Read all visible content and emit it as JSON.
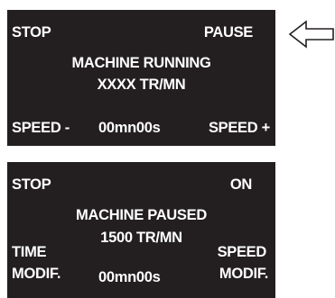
{
  "running_screen": {
    "top_left": "STOP",
    "top_right": "PAUSE",
    "status": "MACHINE RUNNING",
    "speed_readout": "XXXX TR/MN",
    "bottom_left": "SPEED -",
    "timer": "00mn00s",
    "bottom_right": "SPEED +"
  },
  "paused_screen": {
    "top_left": "STOP",
    "top_right": "ON",
    "status": "MACHINE PAUSED",
    "speed_readout": "1500 TR/MN",
    "left_line1": "TIME",
    "left_line2": "MODIF.",
    "timer": "00mn00s",
    "right_line1": "SPEED",
    "right_line2": "MODIF."
  },
  "colors": {
    "screen_bg": "#231f20",
    "text": "#ffffff"
  },
  "icons": {
    "pointer": "left-arrow-icon"
  }
}
